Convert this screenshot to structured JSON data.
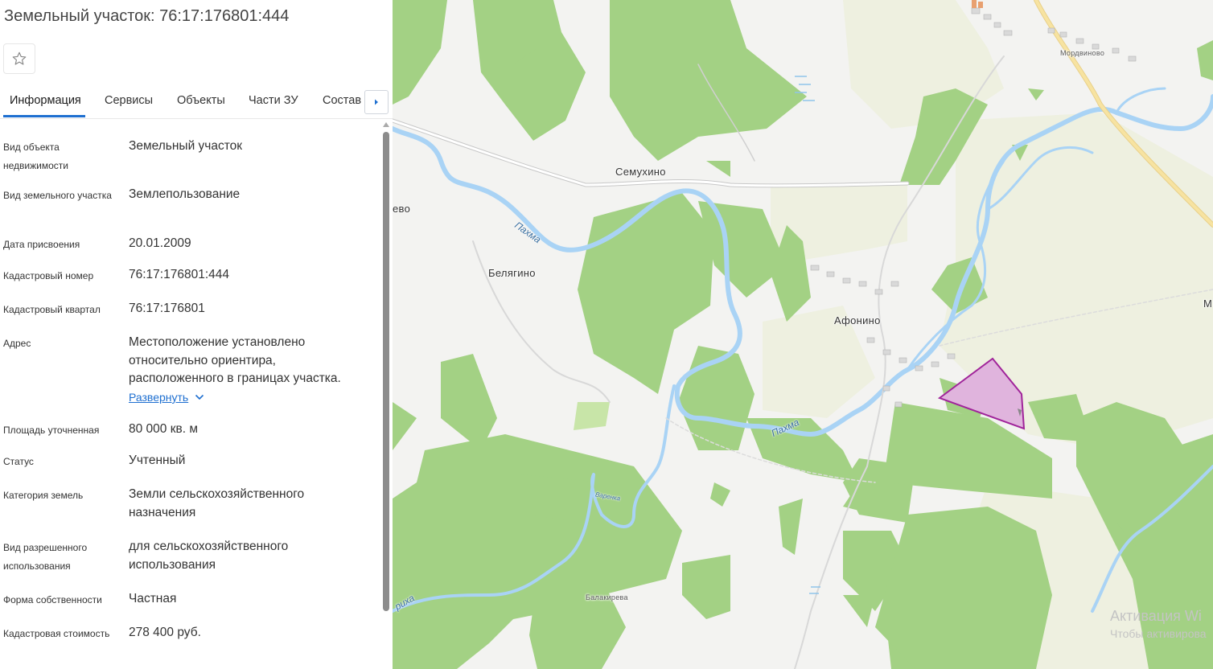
{
  "title": "Земельный участок: 76:17:176801:444",
  "tabs": [
    "Информация",
    "Сервисы",
    "Объекты",
    "Части ЗУ",
    "Состав"
  ],
  "active_tab": "Информация",
  "properties": [
    {
      "label": "Вид объекта недвижимости",
      "value": "Земельный участок"
    },
    {
      "label": "Вид земельного участка",
      "value": "Землепользование"
    },
    {
      "label": "Дата присвоения",
      "value": "20.01.2009"
    },
    {
      "label": "Кадастровый номер",
      "value": "76:17:176801:444"
    },
    {
      "label": "Кадастровый квартал",
      "value": "76:17:176801"
    },
    {
      "label": "Адрес",
      "value": "Местоположение установлено относительно ориентира, расположенного в границах участка."
    },
    {
      "label": "Площадь уточненная",
      "value": "80 000 кв. м"
    },
    {
      "label": "Статус",
      "value": "Учтенный"
    },
    {
      "label": "Категория земель",
      "value": "Земли сельскохозяйственного назначения"
    },
    {
      "label": "Вид разрешенного использования",
      "value": "для сельскохозяйственного использования"
    },
    {
      "label": "Форма собственности",
      "value": "Частная"
    },
    {
      "label": "Кадастровая стоимость",
      "value": "278 400 руб."
    }
  ],
  "expand_label": "Развернуть",
  "map": {
    "places": {
      "mordvinovo": "Мордвиново",
      "semukhino": "Семухино",
      "belyagino": "Белягино",
      "afonino": "Афонино",
      "balakireva": "Балакирева",
      "evo": "ево",
      "m_edge": "М"
    },
    "rivers": {
      "pakhma": "Пахма",
      "varenka": "Варенка",
      "rikha": "риха"
    },
    "watermark": {
      "line1": "Активация Wi",
      "line2": "Чтобы активирова"
    }
  },
  "colors": {
    "accent": "#1e6fd0",
    "forest": "#a3d184",
    "field": "#eef0e0",
    "water": "#a9d3f5",
    "parcel_fill": "#e0b4dd",
    "parcel_stroke": "#a0249a"
  },
  "icons": {
    "favorite": "star-outline-icon",
    "tabs_next": "caret-right-icon",
    "expand": "chevron-down-icon"
  }
}
